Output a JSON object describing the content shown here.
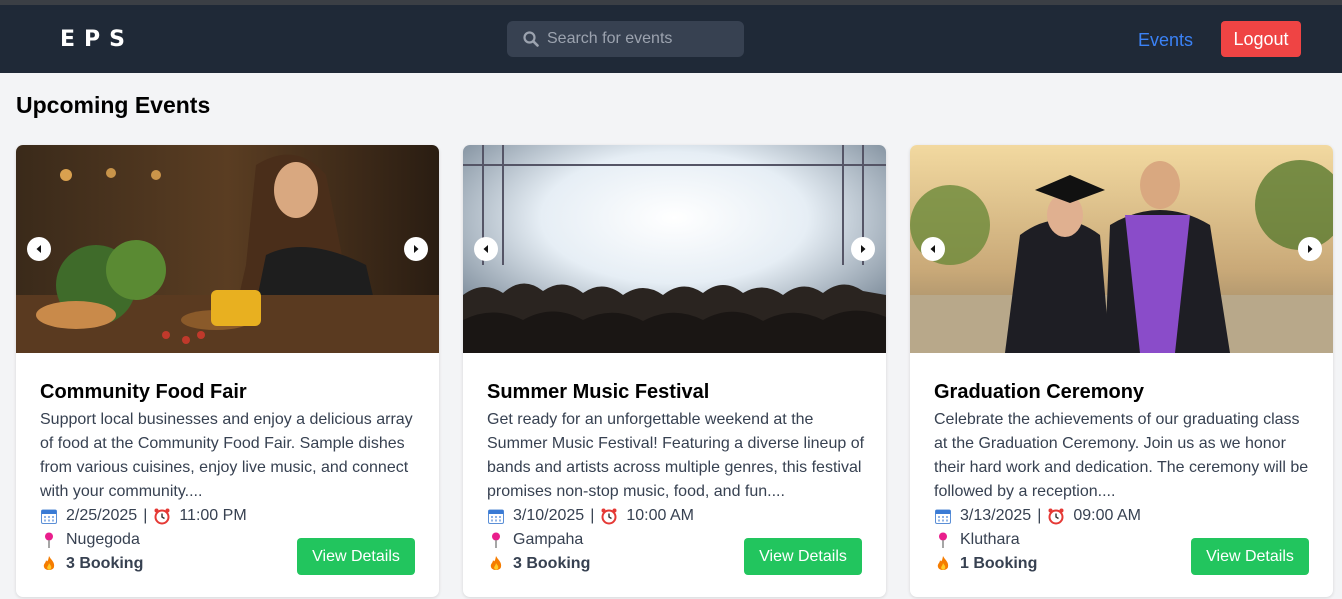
{
  "header": {
    "logo": "EPS",
    "search_placeholder": "Search for events",
    "nav_events": "Events",
    "logout_label": "Logout"
  },
  "page": {
    "section_title": "Upcoming Events"
  },
  "events": [
    {
      "title": "Community Food Fair",
      "description": "Support local businesses and enjoy a delicious array of food at the Community Food Fair. Sample dishes from various cuisines, enjoy live music, and connect with your community....",
      "date": "2/25/2025",
      "time": "11:00 PM",
      "location": "Nugegoda",
      "bookings": "3 Booking",
      "button": "View Details"
    },
    {
      "title": "Summer Music Festival",
      "description": "Get ready for an unforgettable weekend at the Summer Music Festival! Featuring a diverse lineup of bands and artists across multiple genres, this festival promises non-stop music, food, and fun....",
      "date": "3/10/2025",
      "time": "10:00 AM",
      "location": "Gampaha",
      "bookings": "3 Booking",
      "button": "View Details"
    },
    {
      "title": "Graduation Ceremony",
      "description": "Celebrate the achievements of our graduating class at the Graduation Ceremony. Join us as we honor their hard work and dedication. The ceremony will be followed by a reception....",
      "date": "3/13/2025",
      "time": "09:00 AM",
      "location": "Kluthara",
      "bookings": "1 Booking",
      "button": "View Details"
    }
  ],
  "colors": {
    "navbar": "#1f2937",
    "accent_link": "#3b82f6",
    "logout": "#ef4444",
    "view_button": "#22c55e"
  },
  "icons": [
    "search-icon",
    "chevron-left-icon",
    "chevron-right-icon",
    "calendar-icon",
    "alarm-clock-icon",
    "pushpin-icon",
    "fire-icon"
  ]
}
